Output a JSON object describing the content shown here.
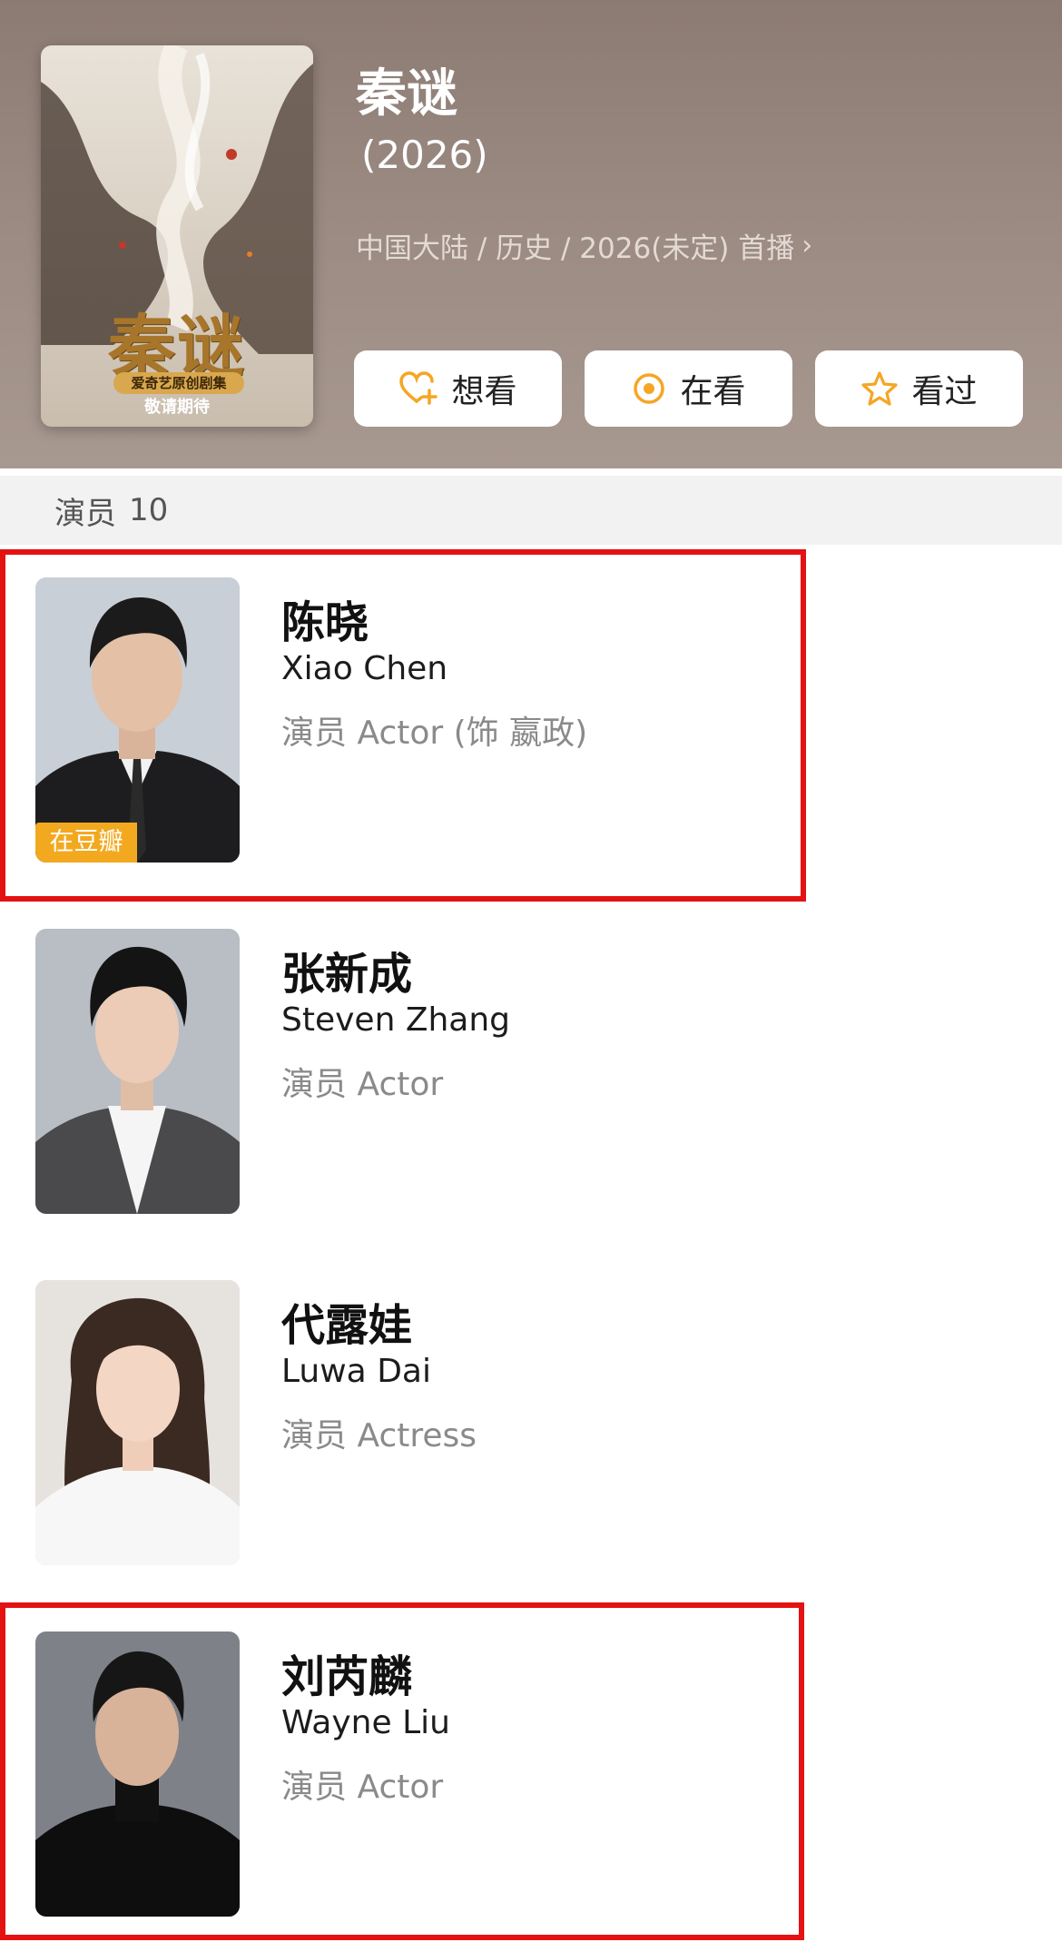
{
  "movie": {
    "title": "秦谜",
    "year": "(2026)",
    "meta": "中国大陆 / 历史 / 2026(未定) 首播",
    "poster": {
      "title": "秦谜",
      "tag": "爱奇艺原创剧集",
      "caption": "敬请期待"
    }
  },
  "actions": [
    {
      "label": "想看",
      "icon": "heart-plus-icon",
      "color": "#f5a623"
    },
    {
      "label": "在看",
      "icon": "circle-dot-icon",
      "color": "#f5a623"
    },
    {
      "label": "看过",
      "icon": "star-icon",
      "color": "#f5a623"
    }
  ],
  "section": {
    "label": "演员",
    "count": "10"
  },
  "cast": [
    {
      "name": "陈晓",
      "en": "Xiao Chen",
      "role": "演员 Actor (饰 嬴政)",
      "badge": "在豆瓣"
    },
    {
      "name": "张新成",
      "en": "Steven Zhang",
      "role": "演员 Actor"
    },
    {
      "name": "代露娃",
      "en": "Luwa Dai",
      "role": "演员 Actress"
    },
    {
      "name": "刘芮麟",
      "en": "Wayne Liu",
      "role": "演员 Actor"
    }
  ],
  "colors": {
    "highlight": "#e41212",
    "accent": "#f5a623",
    "badge": "#f3a91f"
  }
}
